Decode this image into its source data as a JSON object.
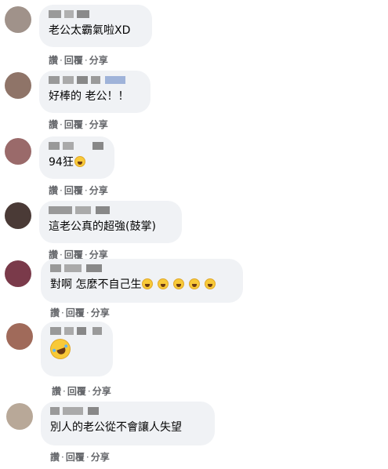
{
  "action_labels": {
    "like": "讚",
    "reply": "回覆",
    "share": "分享",
    "separator": "·"
  },
  "colors": {
    "bubble": "#f0f2f5",
    "action_text": "#65676b",
    "emoji": "#f8c938"
  },
  "comments": [
    {
      "text": "老公太霸氣啦XD",
      "avatar_color": "#a0928a"
    },
    {
      "text": "好棒的 老公！！",
      "avatar_color": "#8f7468"
    },
    {
      "text": "94狂",
      "emoji": "laughing-emoji",
      "avatar_color": "#9a6a6a"
    },
    {
      "text": "這老公真的超強(鼓掌)",
      "avatar_color": "#4a3a36"
    },
    {
      "text": "對啊 怎麼不自己生",
      "emoji": "laughing-emoji",
      "emoji_count": 5,
      "avatar_color": "#7a3a4a"
    },
    {
      "text": "",
      "emoji": "rolling-laughing-emoji",
      "avatar_color": "#a06a5a"
    },
    {
      "text": "別人的老公從不會讓人失望",
      "avatar_color": "#b8a898"
    }
  ]
}
